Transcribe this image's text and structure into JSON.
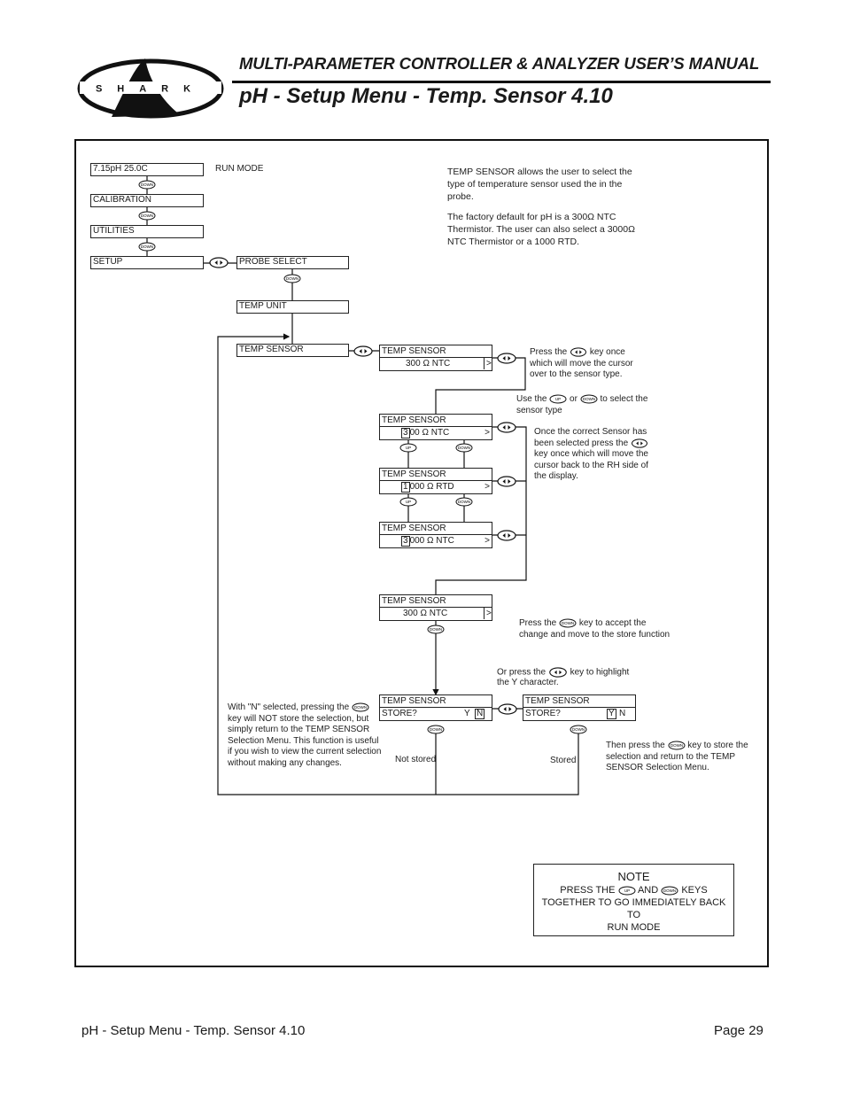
{
  "header": {
    "logo_text": "SHARK",
    "manual_title": "MULTI-PARAMETER CONTROLLER & ANALYZER USER’S MANUAL",
    "page_title": "pH - Setup Menu - Temp. Sensor 4.10"
  },
  "keys": {
    "down": "DOWN",
    "up": "UP"
  },
  "menu": {
    "run_display": "7.15pH   25.0C",
    "run_mode_label": "RUN MODE",
    "calibration": "CALIBRATION",
    "utilities": "UTILITIES",
    "setup": "SETUP",
    "probe_select": "PROBE SELECT",
    "temp_unit": "TEMP UNIT",
    "temp_sensor": "TEMP SENSOR"
  },
  "displays": {
    "title": "TEMP SENSOR",
    "first": {
      "value": "300 Ω NTC",
      "arrow": ">"
    },
    "option_300": {
      "cursor": "3",
      "rest": "00 Ω  NTC",
      "arrow": ">"
    },
    "option_1000": {
      "cursor": "1",
      "rest": "000 Ω RTD",
      "arrow": ">"
    },
    "option_3000": {
      "cursor": "3",
      "rest": "000  Ω  NTC",
      "arrow": ">"
    },
    "accept": {
      "value": "300  Ω NTC",
      "arrow": ">"
    },
    "store_n": {
      "label": "STORE?",
      "y": "Y",
      "n": "N"
    },
    "store_y": {
      "label": "STORE?",
      "y": "Y",
      "n": "N"
    }
  },
  "descriptions": {
    "intro_p1": "TEMP SENSOR allows the user to select the type of temperature sensor used the in the probe.",
    "intro_p2": "The factory default for pH is a 300Ω NTC Thermistor. The user can also select a 3000Ω NTC Thermistor or a 1000 RTD.",
    "press_lr_a": "Press the",
    "press_lr_b": "key once which will move the cursor over to the sensor type.",
    "use_a": "Use the",
    "use_or": "or",
    "use_b": "to select the sensor type",
    "once_a": "Once the correct Sensor has been selected press the",
    "once_b": "key once which will move the cursor back to the RH side of the display.",
    "accept_a": "Press the",
    "accept_b": "key to accept the change and move to the store function",
    "highlight_a": "Or press the",
    "highlight_b": "key to highlight the Y character.",
    "n_selected_a": "With \"N\" selected, pressing the",
    "n_selected_b": "key will NOT store the selection, but simply return to the TEMP SENSOR Selection Menu. This function is useful if you wish to view the current selection without making any changes.",
    "not_stored": "Not stored",
    "stored": "Stored",
    "then_a": "Then press the",
    "then_b": "key to store the selection and return to the TEMP SENSOR Selection Menu."
  },
  "note": {
    "title": "NOTE",
    "line1_a": "PRESS THE",
    "line1_and": "AND",
    "line1_b": "KEYS",
    "line2": "TOGETHER TO GO IMMEDIATELY BACK TO",
    "line3": "RUN MODE"
  },
  "footer": {
    "section": "pH - Setup Menu - Temp. Sensor 4.10",
    "page": "Page 29"
  }
}
